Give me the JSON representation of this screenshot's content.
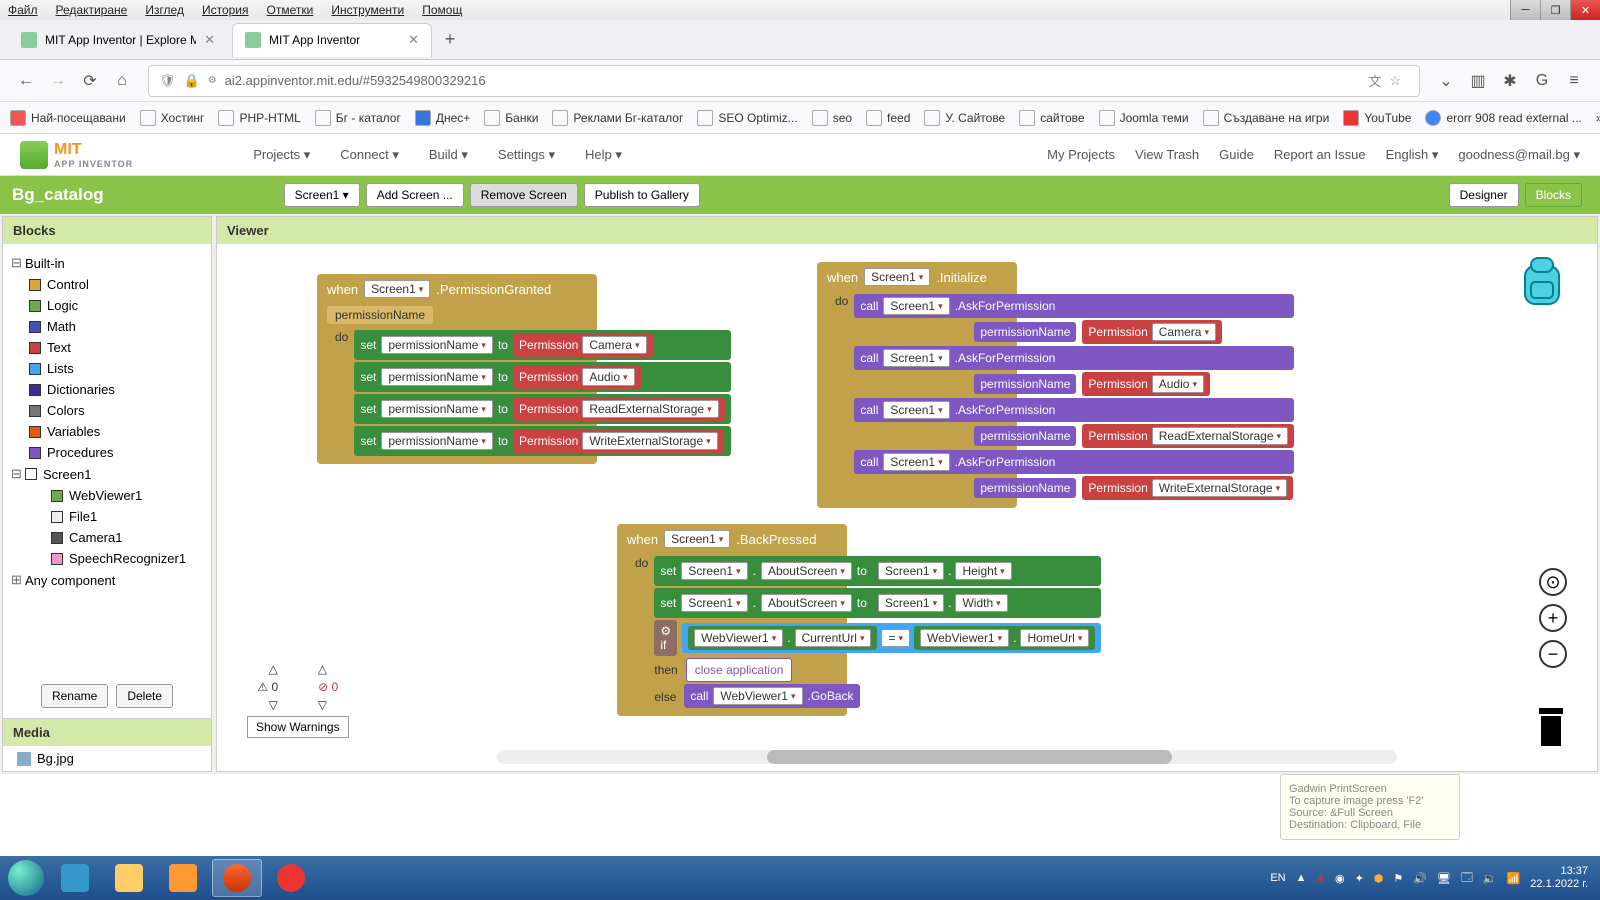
{
  "menubar": [
    "Файл",
    "Редактиране",
    "Изглед",
    "История",
    "Отметки",
    "Инструменти",
    "Помощ"
  ],
  "tabs": [
    {
      "title": "MIT App Inventor | Explore MIT",
      "active": false
    },
    {
      "title": "MIT App Inventor",
      "active": true
    }
  ],
  "url": "ai2.appinventor.mit.edu/#5932549800329216",
  "bookmarks": [
    "Най-посещавани",
    "Хостинг",
    "PHP-HTML",
    "Бг - каталог",
    "Днес+",
    "Банки",
    "Реклами Бг-каталог",
    "SEO Optimiz...",
    "seo",
    "feed",
    "У. Сайтове",
    "сайтове",
    "Joomla теми",
    "Създаване на игри",
    "YouTube",
    "erorr 908 read external ..."
  ],
  "logo": {
    "title": "MIT",
    "sub": "APP INVENTOR"
  },
  "topmenu": [
    "Projects ▾",
    "Connect ▾",
    "Build ▾",
    "Settings ▾",
    "Help ▾"
  ],
  "rightmenu": [
    "My Projects",
    "View Trash",
    "Guide",
    "Report an Issue",
    "English ▾",
    "goodness@mail.bg ▾"
  ],
  "project": "Bg_catalog",
  "projbtns": {
    "screen": "Screen1 ▾",
    "add": "Add Screen ...",
    "remove": "Remove Screen",
    "publish": "Publish to Gallery",
    "designer": "Designer",
    "blocks": "Blocks"
  },
  "panels": {
    "blocks": "Blocks",
    "viewer": "Viewer",
    "media": "Media"
  },
  "builtin": [
    "Control",
    "Logic",
    "Math",
    "Text",
    "Lists",
    "Dictionaries",
    "Colors",
    "Variables",
    "Procedures"
  ],
  "builtinColors": [
    "#d9a441",
    "#6fa84f",
    "#3f51b5",
    "#c94141",
    "#42a5f5",
    "#3f2b96",
    "#757575",
    "#e55b13",
    "#7e57c2"
  ],
  "components": {
    "root": "Screen1",
    "items": [
      "WebViewer1",
      "File1",
      "Camera1",
      "SpeechRecognizer1"
    ],
    "any": "Any component"
  },
  "panelbtns": {
    "rename": "Rename",
    "delete": "Delete"
  },
  "media_items": [
    "Bg.jpg"
  ],
  "warnings": {
    "warn": "0",
    "err": "0",
    "btn": "Show Warnings"
  },
  "block1": {
    "when": "when",
    "screen": "Screen1",
    "event": ".PermissionGranted",
    "param": "permissionName",
    "do": "do",
    "rows": [
      {
        "set": "set",
        "var": "permissionName",
        "to": "to",
        "perm": "Permission",
        "val": "Camera"
      },
      {
        "set": "set",
        "var": "permissionName",
        "to": "to",
        "perm": "Permission",
        "val": "Audio"
      },
      {
        "set": "set",
        "var": "permissionName",
        "to": "to",
        "perm": "Permission",
        "val": "ReadExternalStorage"
      },
      {
        "set": "set",
        "var": "permissionName",
        "to": "to",
        "perm": "Permission",
        "val": "WriteExternalStorage"
      }
    ]
  },
  "block2": {
    "when": "when",
    "screen": "Screen1",
    "event": ".Initialize",
    "do": "do",
    "calls": [
      {
        "call": "call",
        "screen": "Screen1",
        "method": ".AskForPermission",
        "paramlbl": "permissionName",
        "perm": "Permission",
        "val": "Camera"
      },
      {
        "call": "call",
        "screen": "Screen1",
        "method": ".AskForPermission",
        "paramlbl": "permissionName",
        "perm": "Permission",
        "val": "Audio"
      },
      {
        "call": "call",
        "screen": "Screen1",
        "method": ".AskForPermission",
        "paramlbl": "permissionName",
        "perm": "Permission",
        "val": "ReadExternalStorage"
      },
      {
        "call": "call",
        "screen": "Screen1",
        "method": ".AskForPermission",
        "paramlbl": "permissionName",
        "perm": "Permission",
        "val": "WriteExternalStorage"
      }
    ]
  },
  "block3": {
    "when": "when",
    "screen": "Screen1",
    "event": ".BackPressed",
    "do": "do",
    "sets": [
      {
        "set": "set",
        "s1": "Screen1",
        "prop": "AboutScreen",
        "to": "to",
        "s2": "Screen1",
        "prop2": "Height"
      },
      {
        "set": "set",
        "s1": "Screen1",
        "prop": "AboutScreen",
        "to": "to",
        "s2": "Screen1",
        "prop2": "Width"
      }
    ],
    "if": "if",
    "wv1": "WebViewer1",
    "curl": "CurrentUrl",
    "eq": "=",
    "wv2": "WebViewer1",
    "hurl": "HomeUrl",
    "then": "then",
    "closeapp": "close application",
    "else": "else",
    "call": "call",
    "wv3": "WebViewer1",
    "goback": ".GoBack"
  },
  "tray": {
    "lang": "EN",
    "time": "13:37",
    "date": "22.1.2022 г."
  },
  "tooltip": {
    "title": "Gadwin PrintScreen",
    "l1": "To capture image press 'F2'",
    "l2": "Source: &Full Screen",
    "l3": "Destination: Clipboard, File"
  }
}
